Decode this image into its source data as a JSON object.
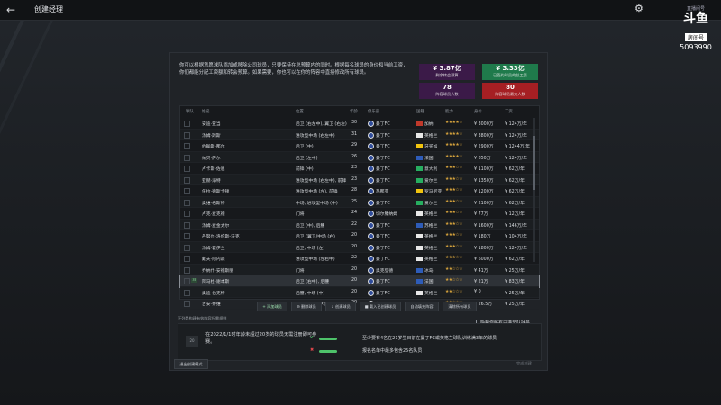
{
  "window": {
    "title": "创建经理",
    "back_icon": "arrow-left-icon",
    "settings_icon": "gear-icon"
  },
  "watermark": {
    "top": "直播间号",
    "logo": "斗鱼",
    "sub": "房间号",
    "number": "5093990"
  },
  "intro": "你可以根据意愿球队添加或移除公司球员，只要保持在总预算内的同时。根据每名球员的身价和当前工资，你们都能分配工资额和转会预算。如果需要，你也可以在你的阵容中直接修改所有球员。",
  "stats": {
    "transfer_budget_value": "¥ 3.87亿",
    "transfer_budget_label": "剩余转会预算",
    "wage_budget_value": "¥ 3.33亿",
    "wage_budget_label": "已签约球员的总工资",
    "squad_count_value": "78",
    "squad_count_label": "阵容球员人数",
    "max_value": "80",
    "max_label": "阵容球员最大人数"
  },
  "table": {
    "headers": [
      "球队",
      "姓名",
      "位置",
      "年龄",
      "俱乐部",
      "国籍",
      "能力",
      "身价",
      "工资"
    ],
    "rows": [
      {
        "tag": "",
        "name": "安迪·亚当",
        "pos": "后卫 (右左中), 翼卫 (右左)",
        "age": "30",
        "club": "曼丁FC",
        "nat": "加纳",
        "flag": "#c0392b",
        "stars": "★★★★☆",
        "value": "¥ 3000万",
        "wage": "¥ 124万/年"
      },
      {
        "tag": "",
        "name": "汤姆·斯斯",
        "pos": "进攻型中场 (右左中)",
        "age": "31",
        "club": "曼丁FC",
        "nat": "英格兰",
        "flag": "#e8e8e8",
        "stars": "★★★★☆",
        "value": "¥ 3800万",
        "wage": "¥ 124万/年"
      },
      {
        "tag": "",
        "name": "约翰斯·那尔",
        "pos": "后卫 (中)",
        "age": "29",
        "club": "曼丁FC",
        "nat": "牙买加",
        "flag": "#f1c40f",
        "stars": "★★★★☆",
        "value": "¥ 2900万",
        "wage": "¥ 1244万/年"
      },
      {
        "tag": "",
        "name": "纳贝·萨尔",
        "pos": "后卫 (左中)",
        "age": "26",
        "club": "曼丁FC",
        "nat": "法国",
        "flag": "#2e5cb8",
        "stars": "★★★★☆",
        "value": "¥ 850万",
        "wage": "¥ 124万/年"
      },
      {
        "tag": "",
        "name": "卢卡斯·佐恩",
        "pos": "前锋 (中)",
        "age": "23",
        "club": "曼丁FC",
        "nat": "意大利",
        "flag": "#27ae60",
        "stars": "★★★☆☆",
        "value": "¥ 1100万",
        "wage": "¥ 62万/年"
      },
      {
        "tag": "",
        "name": "亚赫·海特",
        "pos": "进攻型中场 (右左中), 前锋",
        "age": "23",
        "club": "曼丁FC",
        "nat": "爱尔兰",
        "flag": "#27ae60",
        "stars": "★★★☆☆",
        "value": "¥ 1350万",
        "wage": "¥ 62万/年"
      },
      {
        "tag": "",
        "name": "伍拉·德斯卡顿",
        "pos": "进攻型中场 (左), 前锋",
        "age": "28",
        "club": "热那亚",
        "nat": "罗马尼亚",
        "flag": "#f1c40f",
        "stars": "★★★☆☆",
        "value": "¥ 1200万",
        "wage": "¥ 62万/年"
      },
      {
        "tag": "",
        "name": "奥维·格斯特",
        "pos": "中场, 进攻型中场 (中)",
        "age": "25",
        "club": "曼丁FC",
        "nat": "爱尔兰",
        "flag": "#27ae60",
        "stars": "★★★☆☆",
        "value": "¥ 2100万",
        "wage": "¥ 62万/年"
      },
      {
        "tag": "",
        "name": "卢克·麦克德",
        "pos": "门将",
        "age": "24",
        "club": "切尔滕纳姆",
        "nat": "英格兰",
        "flag": "#e8e8e8",
        "stars": "★★★☆☆",
        "value": "¥ 77万",
        "wage": "¥ 12万/年"
      },
      {
        "tag": "",
        "name": "汤姆·麦金太尔",
        "pos": "后卫 (中), 后腰",
        "age": "22",
        "club": "曼丁FC",
        "nat": "苏格兰",
        "flag": "#2e5cb8",
        "stars": "★★★☆☆",
        "value": "¥ 1600万",
        "wage": "¥ 146万/年"
      },
      {
        "tag": "",
        "name": "丹努尔·洛伦斯-沃克",
        "pos": "后卫 (翼卫/中场 (右)",
        "age": "20",
        "club": "曼丁FC",
        "nat": "英格兰",
        "flag": "#e8e8e8",
        "stars": "★★★☆☆",
        "value": "¥ 180万",
        "wage": "¥ 104万/年"
      },
      {
        "tag": "",
        "name": "汤姆·霍伊兰",
        "pos": "后卫, 中场 (左)",
        "age": "20",
        "club": "曼丁FC",
        "nat": "英格兰",
        "flag": "#e8e8e8",
        "stars": "★★★☆☆",
        "value": "¥ 1800万",
        "wage": "¥ 124万/年"
      },
      {
        "tag": "",
        "name": "戴夫·阿内森",
        "pos": "进攻型中场 (左右中)",
        "age": "22",
        "club": "曼丁FC",
        "nat": "英格兰",
        "flag": "#e8e8e8",
        "stars": "★★★☆☆",
        "value": "¥ 6000万",
        "wage": "¥ 62万/年"
      },
      {
        "tag": "",
        "name": "乔纳什·安德斯丽",
        "pos": "门将",
        "age": "20",
        "club": "奥克登德",
        "nat": "冰岛",
        "flag": "#2e5cb8",
        "stars": "★★☆☆☆",
        "value": "¥ 41万",
        "wage": "¥ 25万/年"
      },
      {
        "tag": "3T",
        "name": "阿马杜·谢本斯",
        "pos": "后卫 (右中), 后腰",
        "age": "20",
        "club": "曼丁FC",
        "nat": "法国",
        "flag": "#2e5cb8",
        "stars": "★★☆☆☆",
        "value": "¥ 21万",
        "wage": "¥ 83万/年",
        "selected": true
      },
      {
        "tag": "",
        "name": "奥迪·伯克特",
        "pos": "后腰, 中场 (中)",
        "age": "20",
        "club": "曼丁FC",
        "nat": "英格兰",
        "flag": "#e8e8e8",
        "stars": "★★☆☆☆",
        "value": "¥ 0",
        "wage": "¥ 25万/年"
      },
      {
        "tag": "",
        "name": "吉安·乔维",
        "pos": "中场/进攻型中场 (中)",
        "age": "20",
        "club": "普尔本",
        "nat": "爱尔兰",
        "flag": "#27ae60",
        "stars": "★★☆☆☆",
        "value": "¥ 26.5万",
        "wage": "¥ 25万/年"
      }
    ]
  },
  "actions": [
    "添加球员",
    "删除球员",
    "创建球员",
    "载入已创建球员",
    "自动填充阵容",
    "清除所有球员"
  ],
  "requirements": {
    "label": "下列是构建有效阵容所需规则",
    "text": "在2022/1/1时年龄未超过20岁的球员无需注册即可参赛。",
    "items": [
      {
        "status": "ok",
        "text": "至少要有4名在21岁生日前在曼丁FC或英格兰球队训练满3年的球员"
      },
      {
        "status": "no",
        "text": "报名名单中最多包含25名队员"
      }
    ],
    "checkbox_label": "隐藏您所有已满足队球员"
  },
  "footer": {
    "left": "退出创建模式",
    "right": "完成创建"
  }
}
